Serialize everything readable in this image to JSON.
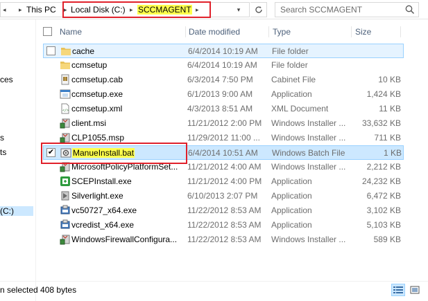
{
  "address": {
    "crumbs": [
      "This PC",
      "Local Disk (C:)",
      "SCCMAGENT"
    ],
    "dropdown_glyph": "▾"
  },
  "search": {
    "placeholder": "Search SCCMAGENT"
  },
  "nav_fragments": [
    "ces",
    "s",
    "ts",
    "(C:)"
  ],
  "columns": {
    "name": "Name",
    "date": "Date modified",
    "type": "Type",
    "size": "Size"
  },
  "files": [
    {
      "name": "cache",
      "date": "6/4/2014 10:19 AM",
      "type": "File folder",
      "size": "",
      "icon": "folder-icon"
    },
    {
      "name": "ccmsetup",
      "date": "6/4/2014 10:19 AM",
      "type": "File folder",
      "size": "",
      "icon": "folder-icon"
    },
    {
      "name": "ccmsetup.cab",
      "date": "6/3/2014 7:50 PM",
      "type": "Cabinet File",
      "size": "10 KB",
      "icon": "cab-file-icon"
    },
    {
      "name": "ccmsetup.exe",
      "date": "6/1/2013 9:00 AM",
      "type": "Application",
      "size": "1,424 KB",
      "icon": "exe-file-icon"
    },
    {
      "name": "ccmsetup.xml",
      "date": "4/3/2013 8:51 AM",
      "type": "XML Document",
      "size": "11 KB",
      "icon": "xml-file-icon"
    },
    {
      "name": "client.msi",
      "date": "11/21/2012 2:00 PM",
      "type": "Windows Installer ...",
      "size": "33,632 KB",
      "icon": "msi-file-icon"
    },
    {
      "name": "CLP1055.msp",
      "date": "11/29/2012 11:00 ...",
      "type": "Windows Installer ...",
      "size": "711 KB",
      "icon": "msp-file-icon"
    },
    {
      "name": "ManueInstall.bat",
      "date": "6/4/2014 10:51 AM",
      "type": "Windows Batch File",
      "size": "1 KB",
      "icon": "bat-file-icon"
    },
    {
      "name": "MicrosoftPolicyPlatformSet...",
      "date": "11/21/2012 4:00 AM",
      "type": "Windows Installer ...",
      "size": "2,212 KB",
      "icon": "msi-file-icon"
    },
    {
      "name": "SCEPInstall.exe",
      "date": "11/21/2012 4:00 PM",
      "type": "Application",
      "size": "24,232 KB",
      "icon": "scep-exe-icon"
    },
    {
      "name": "Silverlight.exe",
      "date": "6/10/2013 2:07 PM",
      "type": "Application",
      "size": "6,472 KB",
      "icon": "exe-file-icon"
    },
    {
      "name": "vc50727_x64.exe",
      "date": "11/22/2012 8:53 AM",
      "type": "Application",
      "size": "3,102 KB",
      "icon": "exe-file-icon"
    },
    {
      "name": "vcredist_x64.exe",
      "date": "11/22/2012 8:53 AM",
      "type": "Application",
      "size": "5,103 KB",
      "icon": "exe-file-icon"
    },
    {
      "name": "WindowsFirewallConfigura...",
      "date": "11/22/2012 8:53 AM",
      "type": "Windows Installer ...",
      "size": "589 KB",
      "icon": "msi-file-icon"
    }
  ],
  "status": {
    "text": "n selected  408 bytes"
  },
  "colors": {
    "selection": "#cce8ff",
    "selection_border": "#99d1ff",
    "annotation": "#e0202a",
    "highlight": "#ffff4d",
    "header_text": "#4c607a"
  }
}
